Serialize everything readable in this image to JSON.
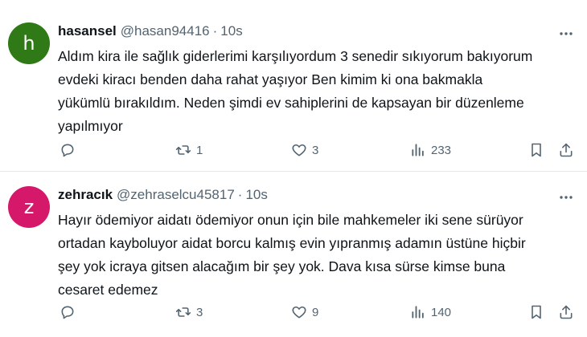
{
  "tweets": [
    {
      "avatar_letter": "h",
      "avatar_color": "#2f7a16",
      "name": "hasansel",
      "handle": "@hasan94416",
      "separator": "·",
      "time": "10s",
      "text": "Aldım kira ile sağlık giderlerimi karşılıyordum 3 senedir sıkıyorum bakıyorum\nevdeki kiracı benden daha rahat yaşıyor Ben kimim ki ona bakmakla\nyükümlü bırakıldım. Neden şimdi ev sahiplerini de kapsayan bir düzenleme\nyapılmıyor",
      "reposts": "1",
      "likes": "3",
      "views": "233"
    },
    {
      "avatar_letter": "z",
      "avatar_color": "#d6186a",
      "name": "zehracık",
      "handle": "@zehraselcu45817",
      "separator": "·",
      "time": "10s",
      "text": "Hayır ödemiyor aidatı ödemiyor onun için bile mahkemeler iki sene sürüyor\nortadan kayboluyor aidat borcu kalmış evin yıpranmış adamın üstüne hiçbir\nşey yok icraya gitsen alacağım bir şey yok. Dava kısa sürse kimse buna\ncesaret edemez",
      "reposts": "3",
      "likes": "9",
      "views": "140"
    }
  ],
  "icons": {
    "more": "more-dots-icon",
    "reply": "reply-icon",
    "repost": "repost-icon",
    "like": "heart-icon",
    "views": "views-icon",
    "bookmark": "bookmark-icon",
    "share": "share-icon"
  },
  "colors": {
    "text": "#0f1419",
    "secondary": "#536471",
    "divider": "#e6e9ea"
  }
}
